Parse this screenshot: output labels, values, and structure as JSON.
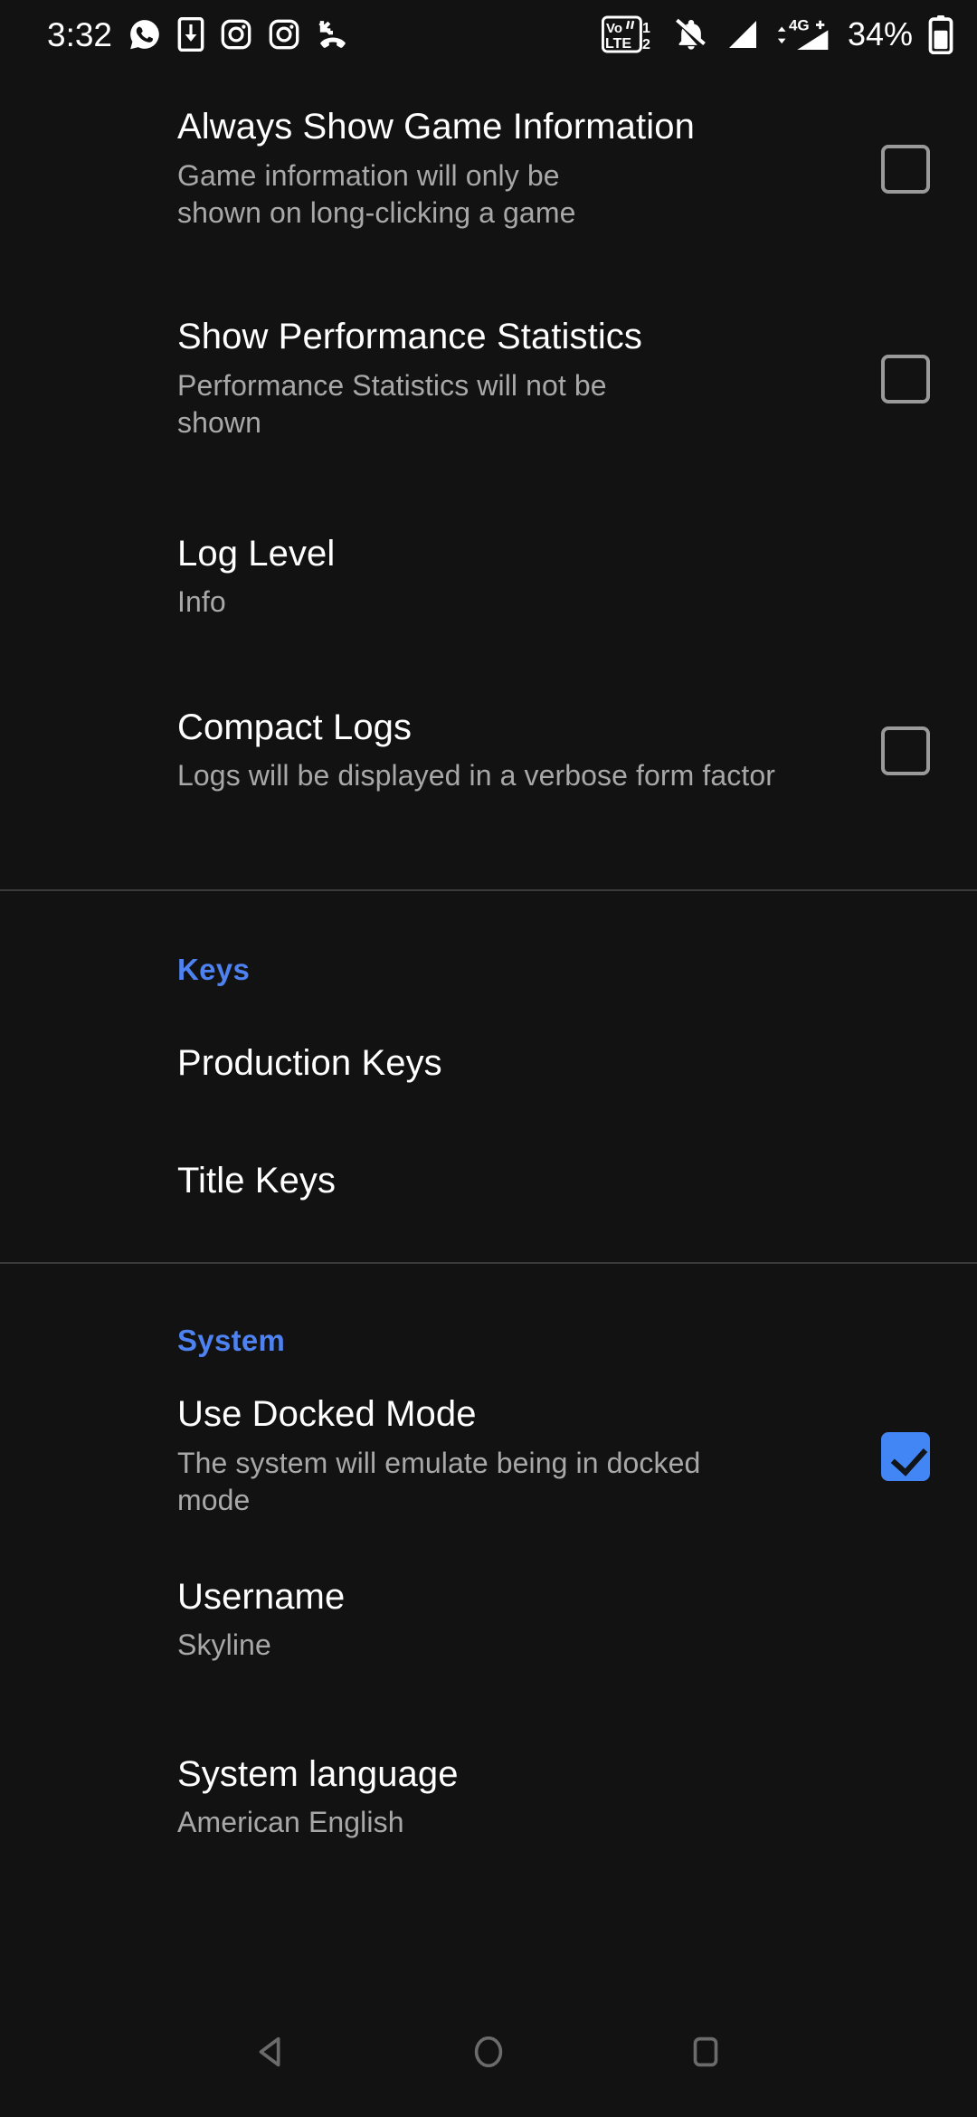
{
  "status_bar": {
    "clock": "3:32",
    "battery_percent": "34%",
    "left_icons": [
      {
        "name": "whatsapp-icon"
      },
      {
        "name": "app-download-icon"
      },
      {
        "name": "instagram-icon"
      },
      {
        "name": "instagram-icon"
      },
      {
        "name": "missed-call-icon"
      }
    ],
    "right_icons": [
      {
        "name": "volte-dual-sim-icon",
        "line1": "Vo",
        "line2": "LTE",
        "sim1": "1",
        "sim2": "2"
      },
      {
        "name": "notifications-silenced-icon"
      },
      {
        "name": "signal-bars-sim1-icon"
      },
      {
        "name": "mobile-data-4g-plus-icon",
        "label": "4G+"
      },
      {
        "name": "battery-icon"
      }
    ]
  },
  "settings": {
    "rows": [
      {
        "id": "always-show-game-information",
        "title": "Always Show Game Information",
        "subtitle": "Game information will only be shown on long-clicking a game",
        "checkbox": "unchecked"
      },
      {
        "id": "show-performance-statistics",
        "title": "Show Performance Statistics",
        "subtitle": "Performance Statistics will not be shown",
        "checkbox": "unchecked"
      },
      {
        "id": "log-level",
        "title": "Log Level",
        "subtitle": "Info",
        "checkbox": "none"
      },
      {
        "id": "compact-logs",
        "title": "Compact Logs",
        "subtitle": "Logs will be displayed in a verbose form factor",
        "checkbox": "unchecked"
      }
    ]
  },
  "keys_section": {
    "header": "Keys",
    "rows": [
      {
        "id": "production-keys",
        "title": "Production Keys"
      },
      {
        "id": "title-keys",
        "title": "Title Keys"
      }
    ]
  },
  "system_section": {
    "header": "System",
    "rows": [
      {
        "id": "use-docked-mode",
        "title": "Use Docked Mode",
        "subtitle": "The system will emulate being in docked mode",
        "checkbox": "checked"
      },
      {
        "id": "username",
        "title": "Username",
        "subtitle": "Skyline",
        "checkbox": "none"
      },
      {
        "id": "system-language",
        "title": "System language",
        "subtitle": "American English",
        "checkbox": "none"
      }
    ]
  },
  "nav_bar": {
    "back": "back-button",
    "home": "home-button",
    "recents": "recents-button"
  },
  "colors": {
    "background": "#121212",
    "accent": "#4d82f0",
    "checkbox_checked": "#4285f4",
    "title_text": "#ffffff",
    "subtitle_text": "#a8a8a8",
    "divider": "#3a3a3a"
  }
}
